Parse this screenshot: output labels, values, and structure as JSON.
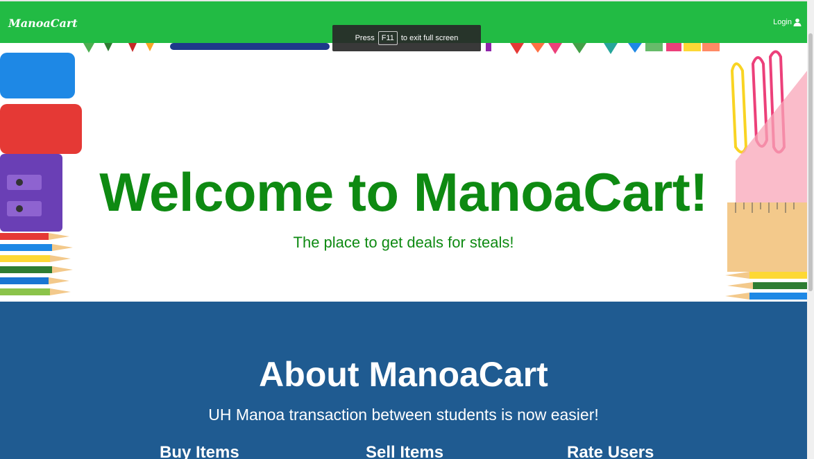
{
  "navbar": {
    "brand": "ManoaCart",
    "login_label": "Login",
    "background": "#22bb44"
  },
  "fullscreen_notice": {
    "prefix": "Press",
    "key": "F11",
    "suffix": "to exit full screen"
  },
  "hero": {
    "title": "Welcome to ManoaCart!",
    "subtitle": "The place to get deals for steals!",
    "text_color": "#0e8a12"
  },
  "about": {
    "title": "About ManoaCart",
    "subtitle": "UH Manoa transaction between students is now easier!",
    "background": "#1f5b91",
    "features": [
      "Buy Items",
      "Sell Items",
      "Rate Users"
    ]
  },
  "icons": {
    "login": "user-icon"
  }
}
